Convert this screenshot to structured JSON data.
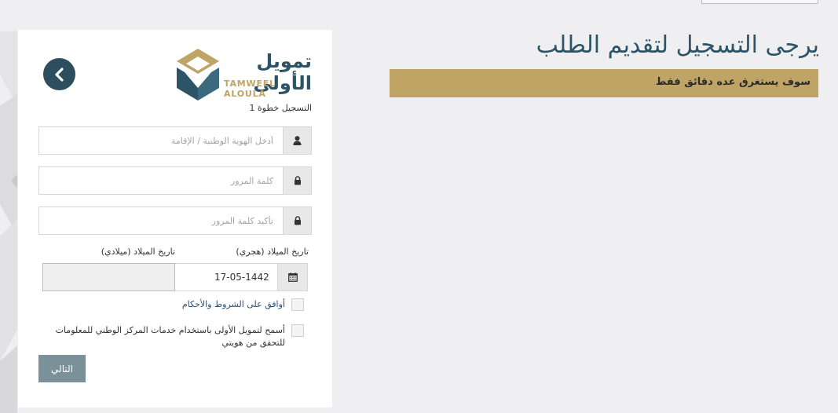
{
  "page": {
    "title": "يرجى التسجيل لتقديم الطلب",
    "notice": "سوف يستغرق عده دقائق فقط"
  },
  "logo": {
    "arabic": "تمويل الأولى",
    "english": "TAMWEEL ALOULA"
  },
  "form": {
    "step_label": "التسجيل خطوة 1",
    "national_id_placeholder": "أدخل الهوية الوطنية / الإقامة",
    "password_placeholder": "كلمة المرور",
    "confirm_password_placeholder": "تأكيد كلمة المرور",
    "dob_hijri_label": "تاريخ الميلاد (هجري)",
    "dob_gregorian_label": "تاريخ الميلاد (ميلادي)",
    "dob_hijri_value": "17-05-1442",
    "terms_label": "أوافق على الشروط والأحكام",
    "consent_label": "أسمح لتمويل الأولى باستخدام خدمات المركز الوطني للمعلومات للتحقق من هويتي",
    "next_label": "التالي"
  },
  "icons": {
    "back": "chevron-left-icon",
    "user": "user-icon",
    "lock": "lock-icon",
    "calendar": "calendar-icon"
  },
  "colors": {
    "primary": "#2d4f5d",
    "accent": "#bfa466",
    "button": "#7a919a",
    "background": "#efeff1"
  }
}
